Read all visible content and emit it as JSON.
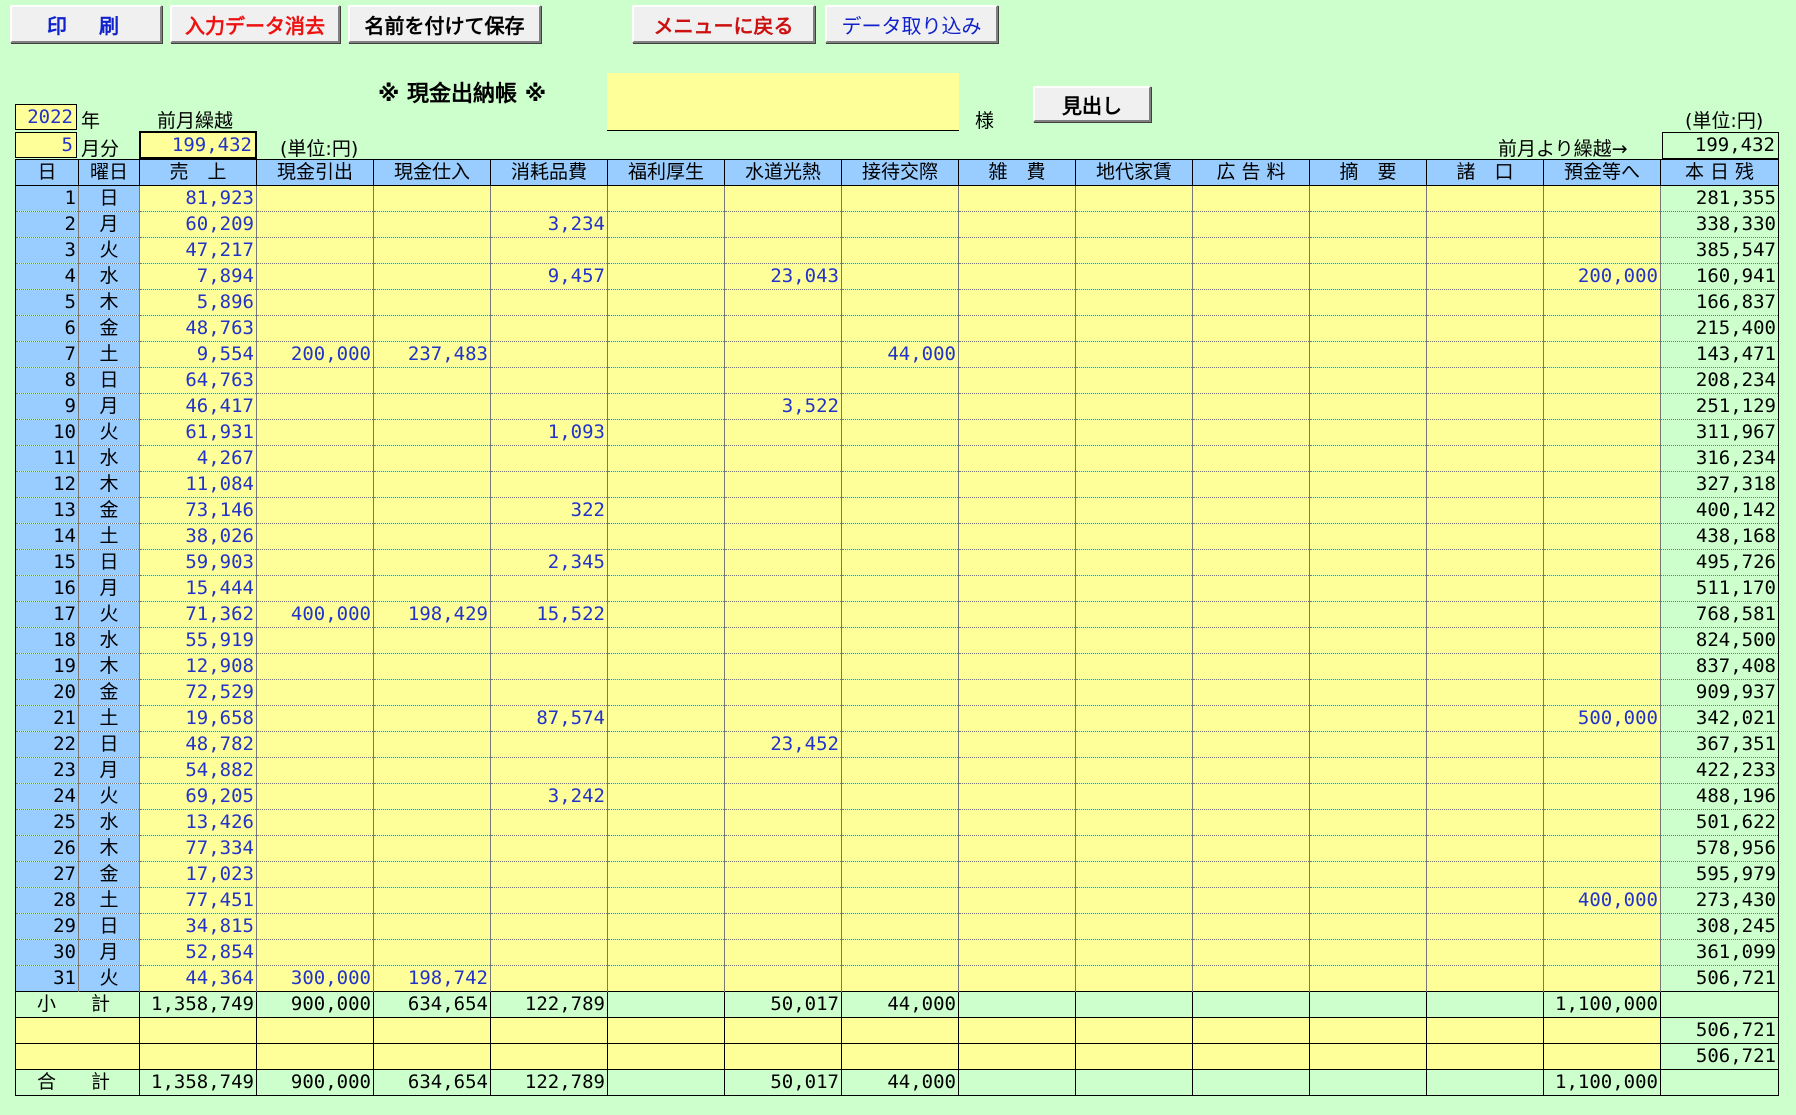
{
  "toolbar": {
    "print": "印　刷",
    "clear": "入力データ消去",
    "save_as": "名前を付けて保存",
    "menu": "メニューに戻る",
    "import": "データ取り込み"
  },
  "header": {
    "title": "※ 現金出納帳 ※",
    "name_value": "",
    "sama": "様",
    "heading_button": "見出し",
    "year": "2022",
    "year_label": "年",
    "month": "5",
    "month_label": "月分",
    "prev_carry_label": "前月繰越",
    "prev_carry_value": "199,432",
    "unit_left": "(単位:円)",
    "unit_right": "(単位:円)",
    "carry_from_prev_label": "前月より繰越→",
    "carry_from_prev_value": "199,432"
  },
  "columns": [
    "日",
    "曜日",
    "売　上",
    "現金引出",
    "現金仕入",
    "消耗品費",
    "福利厚生",
    "水道光熱",
    "接待交際",
    "雑　費",
    "地代家賃",
    "広 告 料",
    "摘　要",
    "諸　口",
    "預金等へ",
    "本 日 残"
  ],
  "rows": [
    [
      "1",
      "日",
      "81,923",
      "",
      "",
      "",
      "",
      "",
      "",
      "",
      "",
      "",
      "",
      "",
      "",
      "281,355"
    ],
    [
      "2",
      "月",
      "60,209",
      "",
      "",
      "3,234",
      "",
      "",
      "",
      "",
      "",
      "",
      "",
      "",
      "",
      "338,330"
    ],
    [
      "3",
      "火",
      "47,217",
      "",
      "",
      "",
      "",
      "",
      "",
      "",
      "",
      "",
      "",
      "",
      "",
      "385,547"
    ],
    [
      "4",
      "水",
      "7,894",
      "",
      "",
      "9,457",
      "",
      "23,043",
      "",
      "",
      "",
      "",
      "",
      "",
      "200,000",
      "160,941"
    ],
    [
      "5",
      "木",
      "5,896",
      "",
      "",
      "",
      "",
      "",
      "",
      "",
      "",
      "",
      "",
      "",
      "",
      "166,837"
    ],
    [
      "6",
      "金",
      "48,763",
      "",
      "",
      "",
      "",
      "",
      "",
      "",
      "",
      "",
      "",
      "",
      "",
      "215,400"
    ],
    [
      "7",
      "土",
      "9,554",
      "200,000",
      "237,483",
      "",
      "",
      "",
      "44,000",
      "",
      "",
      "",
      "",
      "",
      "",
      "143,471"
    ],
    [
      "8",
      "日",
      "64,763",
      "",
      "",
      "",
      "",
      "",
      "",
      "",
      "",
      "",
      "",
      "",
      "",
      "208,234"
    ],
    [
      "9",
      "月",
      "46,417",
      "",
      "",
      "",
      "",
      "3,522",
      "",
      "",
      "",
      "",
      "",
      "",
      "",
      "251,129"
    ],
    [
      "10",
      "火",
      "61,931",
      "",
      "",
      "1,093",
      "",
      "",
      "",
      "",
      "",
      "",
      "",
      "",
      "",
      "311,967"
    ],
    [
      "11",
      "水",
      "4,267",
      "",
      "",
      "",
      "",
      "",
      "",
      "",
      "",
      "",
      "",
      "",
      "",
      "316,234"
    ],
    [
      "12",
      "木",
      "11,084",
      "",
      "",
      "",
      "",
      "",
      "",
      "",
      "",
      "",
      "",
      "",
      "",
      "327,318"
    ],
    [
      "13",
      "金",
      "73,146",
      "",
      "",
      "322",
      "",
      "",
      "",
      "",
      "",
      "",
      "",
      "",
      "",
      "400,142"
    ],
    [
      "14",
      "土",
      "38,026",
      "",
      "",
      "",
      "",
      "",
      "",
      "",
      "",
      "",
      "",
      "",
      "",
      "438,168"
    ],
    [
      "15",
      "日",
      "59,903",
      "",
      "",
      "2,345",
      "",
      "",
      "",
      "",
      "",
      "",
      "",
      "",
      "",
      "495,726"
    ],
    [
      "16",
      "月",
      "15,444",
      "",
      "",
      "",
      "",
      "",
      "",
      "",
      "",
      "",
      "",
      "",
      "",
      "511,170"
    ],
    [
      "17",
      "火",
      "71,362",
      "400,000",
      "198,429",
      "15,522",
      "",
      "",
      "",
      "",
      "",
      "",
      "",
      "",
      "",
      "768,581"
    ],
    [
      "18",
      "水",
      "55,919",
      "",
      "",
      "",
      "",
      "",
      "",
      "",
      "",
      "",
      "",
      "",
      "",
      "824,500"
    ],
    [
      "19",
      "木",
      "12,908",
      "",
      "",
      "",
      "",
      "",
      "",
      "",
      "",
      "",
      "",
      "",
      "",
      "837,408"
    ],
    [
      "20",
      "金",
      "72,529",
      "",
      "",
      "",
      "",
      "",
      "",
      "",
      "",
      "",
      "",
      "",
      "",
      "909,937"
    ],
    [
      "21",
      "土",
      "19,658",
      "",
      "",
      "87,574",
      "",
      "",
      "",
      "",
      "",
      "",
      "",
      "",
      "500,000",
      "342,021"
    ],
    [
      "22",
      "日",
      "48,782",
      "",
      "",
      "",
      "",
      "23,452",
      "",
      "",
      "",
      "",
      "",
      "",
      "",
      "367,351"
    ],
    [
      "23",
      "月",
      "54,882",
      "",
      "",
      "",
      "",
      "",
      "",
      "",
      "",
      "",
      "",
      "",
      "",
      "422,233"
    ],
    [
      "24",
      "火",
      "69,205",
      "",
      "",
      "3,242",
      "",
      "",
      "",
      "",
      "",
      "",
      "",
      "",
      "",
      "488,196"
    ],
    [
      "25",
      "水",
      "13,426",
      "",
      "",
      "",
      "",
      "",
      "",
      "",
      "",
      "",
      "",
      "",
      "",
      "501,622"
    ],
    [
      "26",
      "木",
      "77,334",
      "",
      "",
      "",
      "",
      "",
      "",
      "",
      "",
      "",
      "",
      "",
      "",
      "578,956"
    ],
    [
      "27",
      "金",
      "17,023",
      "",
      "",
      "",
      "",
      "",
      "",
      "",
      "",
      "",
      "",
      "",
      "",
      "595,979"
    ],
    [
      "28",
      "土",
      "77,451",
      "",
      "",
      "",
      "",
      "",
      "",
      "",
      "",
      "",
      "",
      "",
      "400,000",
      "273,430"
    ],
    [
      "29",
      "日",
      "34,815",
      "",
      "",
      "",
      "",
      "",
      "",
      "",
      "",
      "",
      "",
      "",
      "",
      "308,245"
    ],
    [
      "30",
      "月",
      "52,854",
      "",
      "",
      "",
      "",
      "",
      "",
      "",
      "",
      "",
      "",
      "",
      "",
      "361,099"
    ],
    [
      "31",
      "火",
      "44,364",
      "300,000",
      "198,742",
      "",
      "",
      "",
      "",
      "",
      "",
      "",
      "",
      "",
      "",
      "506,721"
    ]
  ],
  "subtotal": {
    "label": "小　計",
    "values": [
      "1,358,749",
      "900,000",
      "634,654",
      "122,789",
      "",
      "50,017",
      "44,000",
      "",
      "",
      "",
      "",
      "",
      "1,100,000",
      ""
    ]
  },
  "extra_rows": [
    {
      "label": "",
      "values": [
        "",
        "",
        "",
        "",
        "",
        "",
        "",
        "",
        "",
        "",
        "",
        "",
        "",
        "506,721"
      ]
    },
    {
      "label": "",
      "values": [
        "",
        "",
        "",
        "",
        "",
        "",
        "",
        "",
        "",
        "",
        "",
        "",
        "",
        "506,721"
      ]
    }
  ],
  "total": {
    "label": "合　計",
    "values": [
      "1,358,749",
      "900,000",
      "634,654",
      "122,789",
      "",
      "50,017",
      "44,000",
      "",
      "",
      "",
      "",
      "",
      "1,100,000",
      ""
    ]
  }
}
